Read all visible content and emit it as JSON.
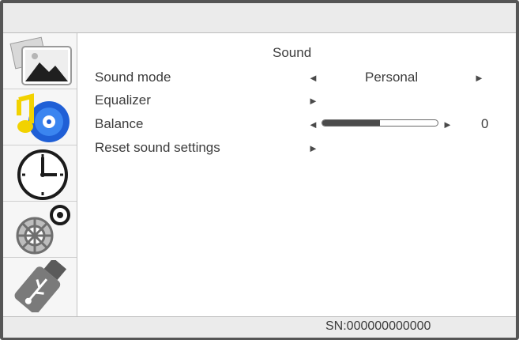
{
  "menu": {
    "title": "Sound",
    "side_tabs": [
      {
        "icon": "picture-icon"
      },
      {
        "icon": "music-icon"
      },
      {
        "icon": "clock-icon"
      },
      {
        "icon": "settings-gears-icon"
      },
      {
        "icon": "usb-icon"
      }
    ],
    "items": [
      {
        "label": "Sound mode",
        "value": "Personal",
        "left_arrow": "◄",
        "right_arrow": "►"
      },
      {
        "label": "Equalizer",
        "right_arrow": "►"
      },
      {
        "label": "Balance",
        "value": "0",
        "left_arrow": "◄",
        "right_arrow": "►",
        "level": 0.5
      },
      {
        "label": "Reset sound settings",
        "right_arrow": "►"
      }
    ]
  },
  "footer": {
    "serial": "SN:000000000000"
  },
  "colors": {
    "frame": "#555555",
    "bars": "#ebebeb",
    "text": "#3c3c3c"
  }
}
